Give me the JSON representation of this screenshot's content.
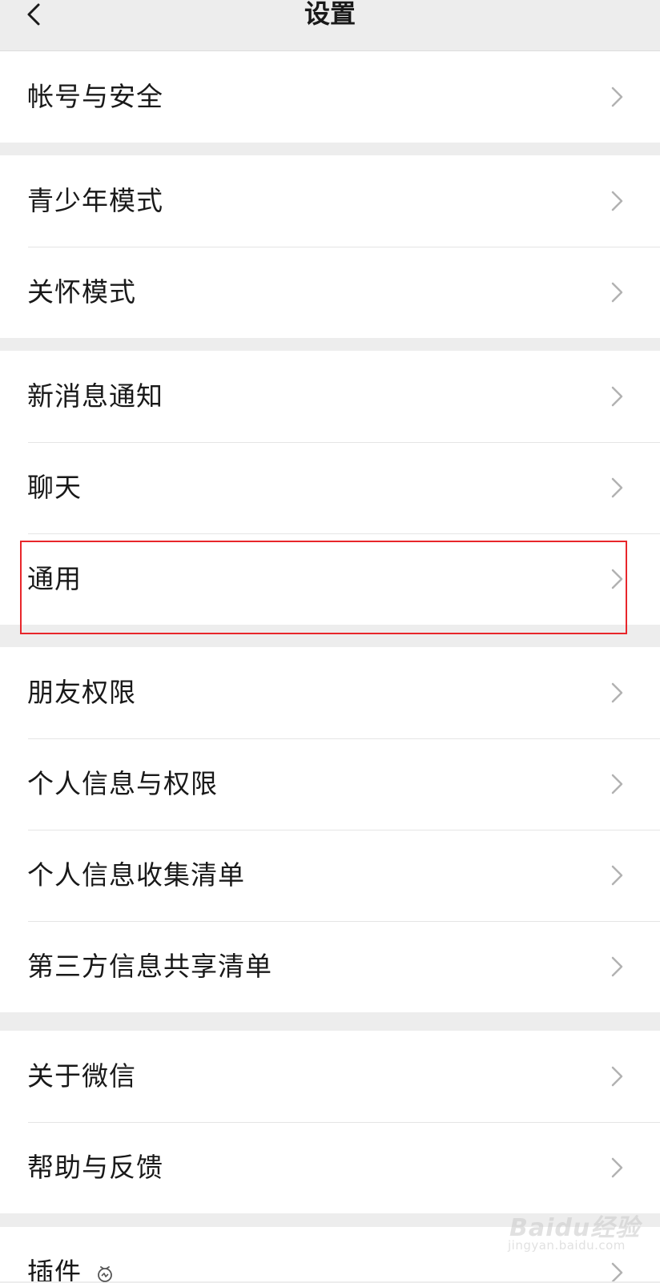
{
  "header": {
    "title": "设置",
    "back_icon": "chevron-left-icon"
  },
  "groups": [
    {
      "items": [
        {
          "label": "帐号与安全"
        }
      ]
    },
    {
      "items": [
        {
          "label": "青少年模式"
        },
        {
          "label": "关怀模式"
        }
      ]
    },
    {
      "items": [
        {
          "label": "新消息通知"
        },
        {
          "label": "聊天"
        },
        {
          "label": "通用",
          "highlighted": true
        }
      ]
    },
    {
      "items": [
        {
          "label": "朋友权限"
        },
        {
          "label": "个人信息与权限"
        },
        {
          "label": "个人信息收集清单"
        },
        {
          "label": "第三方信息共享清单"
        }
      ]
    },
    {
      "items": [
        {
          "label": "关于微信"
        },
        {
          "label": "帮助与反馈"
        }
      ]
    },
    {
      "items": [
        {
          "label": "插件",
          "badge_icon": "plugin-badge-icon"
        }
      ]
    }
  ],
  "watermark": {
    "brand": "Baidu经验",
    "url": "jingyan.baidu.com"
  },
  "colors": {
    "background": "#ededed",
    "cell": "#ffffff",
    "text": "#191919",
    "chevron": "#b2b2b2",
    "highlight_border": "#e8262b"
  }
}
